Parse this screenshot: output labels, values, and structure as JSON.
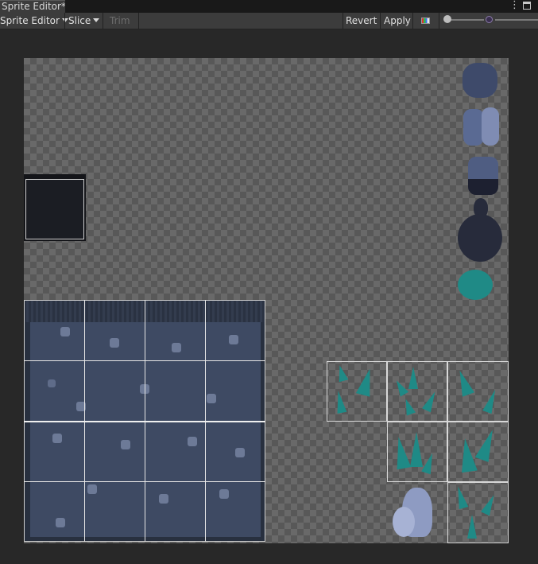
{
  "window": {
    "tab_title": "Sprite Editor*",
    "kebab_icon": "more-vertical-icon",
    "maximize_icon": "maximize-icon"
  },
  "toolbar": {
    "mode_label": "Sprite Editor",
    "slice_label": "Slice",
    "trim_label": "Trim",
    "revert_label": "Revert",
    "apply_label": "Apply",
    "color_channel_icon": "rgb-channels-icon",
    "zoom_slider_value": 0.0,
    "mip_icon": "mip-level-icon"
  },
  "colors": {
    "accent_crystal": "#1f8a86",
    "stone_tile": "#3e4a63",
    "dark_square": "#1a1c22"
  }
}
